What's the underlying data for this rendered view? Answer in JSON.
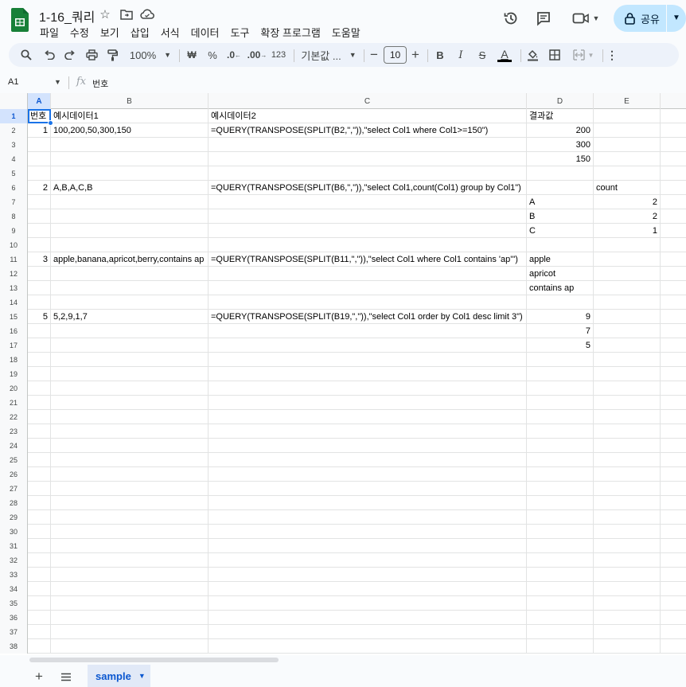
{
  "title_bar": {
    "doc_title": "1-16_쿼리",
    "menus": [
      "파일",
      "수정",
      "보기",
      "삽입",
      "서식",
      "데이터",
      "도구",
      "확장 프로그램",
      "도움말"
    ],
    "share_label": "공유"
  },
  "toolbar": {
    "zoom": "100%",
    "currency": "₩",
    "percent": "%",
    "decimal_decrease": ".0",
    "decimal_increase": ".00",
    "number_format": "123",
    "font_name": "기본값 ...",
    "font_size": "10",
    "bold": "B",
    "italic": "I",
    "strike": "S",
    "text_color": "A"
  },
  "formula_bar": {
    "cell_ref": "A1",
    "fx": "fx",
    "content": "번호"
  },
  "columns": [
    "A",
    "B",
    "C",
    "D",
    "E"
  ],
  "rows": [
    {
      "num": "1",
      "A": "번호",
      "B": "예시데이터1",
      "C": "예시데이터2",
      "D": "결과값",
      "E": ""
    },
    {
      "num": "2",
      "A": "1",
      "B": "100,200,50,300,150",
      "C": "=QUERY(TRANSPOSE(SPLIT(B2,\",\")),\"select Col1 where Col1>=150\")",
      "D": "200",
      "E": ""
    },
    {
      "num": "3",
      "A": "",
      "B": "",
      "C": "",
      "D": "300",
      "E": ""
    },
    {
      "num": "4",
      "A": "",
      "B": "",
      "C": "",
      "D": "150",
      "E": ""
    },
    {
      "num": "5",
      "A": "",
      "B": "",
      "C": "",
      "D": "",
      "E": ""
    },
    {
      "num": "6",
      "A": "2",
      "B": "A,B,A,C,B",
      "C": "=QUERY(TRANSPOSE(SPLIT(B6,\",\")),\"select Col1,count(Col1) group by Col1\")",
      "D": "",
      "E": "count"
    },
    {
      "num": "7",
      "A": "",
      "B": "",
      "C": "",
      "D": "A",
      "E": "2"
    },
    {
      "num": "8",
      "A": "",
      "B": "",
      "C": "",
      "D": "B",
      "E": "2"
    },
    {
      "num": "9",
      "A": "",
      "B": "",
      "C": "",
      "D": "C",
      "E": "1"
    },
    {
      "num": "10",
      "A": "",
      "B": "",
      "C": "",
      "D": "",
      "E": ""
    },
    {
      "num": "11",
      "A": "3",
      "B": "apple,banana,apricot,berry,contains ap",
      "C": "=QUERY(TRANSPOSE(SPLIT(B11,\",\")),\"select Col1 where Col1 contains 'ap'\")",
      "D": "apple",
      "E": ""
    },
    {
      "num": "12",
      "A": "",
      "B": "",
      "C": "",
      "D": "apricot",
      "E": ""
    },
    {
      "num": "13",
      "A": "",
      "B": "",
      "C": "",
      "D": "contains ap",
      "E": ""
    },
    {
      "num": "14",
      "A": "",
      "B": "",
      "C": "",
      "D": "",
      "E": ""
    },
    {
      "num": "15",
      "A": "5",
      "B": "5,2,9,1,7",
      "C": "=QUERY(TRANSPOSE(SPLIT(B19,\",\")),\"select Col1 order by Col1 desc limit 3\")",
      "D": "9",
      "E": ""
    },
    {
      "num": "16",
      "A": "",
      "B": "",
      "C": "",
      "D": "7",
      "E": ""
    },
    {
      "num": "17",
      "A": "",
      "B": "",
      "C": "",
      "D": "5",
      "E": ""
    },
    {
      "num": "18",
      "A": "",
      "B": "",
      "C": "",
      "D": "",
      "E": ""
    },
    {
      "num": "19",
      "A": "",
      "B": "",
      "C": "",
      "D": "",
      "E": ""
    },
    {
      "num": "20",
      "A": "",
      "B": "",
      "C": "",
      "D": "",
      "E": ""
    },
    {
      "num": "21",
      "A": "",
      "B": "",
      "C": "",
      "D": "",
      "E": ""
    },
    {
      "num": "22",
      "A": "",
      "B": "",
      "C": "",
      "D": "",
      "E": ""
    },
    {
      "num": "23",
      "A": "",
      "B": "",
      "C": "",
      "D": "",
      "E": ""
    },
    {
      "num": "24",
      "A": "",
      "B": "",
      "C": "",
      "D": "",
      "E": ""
    },
    {
      "num": "25",
      "A": "",
      "B": "",
      "C": "",
      "D": "",
      "E": ""
    },
    {
      "num": "26",
      "A": "",
      "B": "",
      "C": "",
      "D": "",
      "E": ""
    },
    {
      "num": "27",
      "A": "",
      "B": "",
      "C": "",
      "D": "",
      "E": ""
    },
    {
      "num": "28",
      "A": "",
      "B": "",
      "C": "",
      "D": "",
      "E": ""
    },
    {
      "num": "29",
      "A": "",
      "B": "",
      "C": "",
      "D": "",
      "E": ""
    },
    {
      "num": "30",
      "A": "",
      "B": "",
      "C": "",
      "D": "",
      "E": ""
    },
    {
      "num": "31",
      "A": "",
      "B": "",
      "C": "",
      "D": "",
      "E": ""
    },
    {
      "num": "32",
      "A": "",
      "B": "",
      "C": "",
      "D": "",
      "E": ""
    },
    {
      "num": "33",
      "A": "",
      "B": "",
      "C": "",
      "D": "",
      "E": ""
    },
    {
      "num": "34",
      "A": "",
      "B": "",
      "C": "",
      "D": "",
      "E": ""
    },
    {
      "num": "35",
      "A": "",
      "B": "",
      "C": "",
      "D": "",
      "E": ""
    },
    {
      "num": "36",
      "A": "",
      "B": "",
      "C": "",
      "D": "",
      "E": ""
    },
    {
      "num": "37",
      "A": "",
      "B": "",
      "C": "",
      "D": "",
      "E": ""
    },
    {
      "num": "38",
      "A": "",
      "B": "",
      "C": "",
      "D": "",
      "E": ""
    }
  ],
  "sheet_tabs": [
    {
      "label": "sample",
      "active": true
    }
  ],
  "colors": {
    "accent": "#1a73e8",
    "share_bg": "#c2e7ff",
    "logo": "#188038",
    "tab_active_bg": "#e1e9f7"
  }
}
